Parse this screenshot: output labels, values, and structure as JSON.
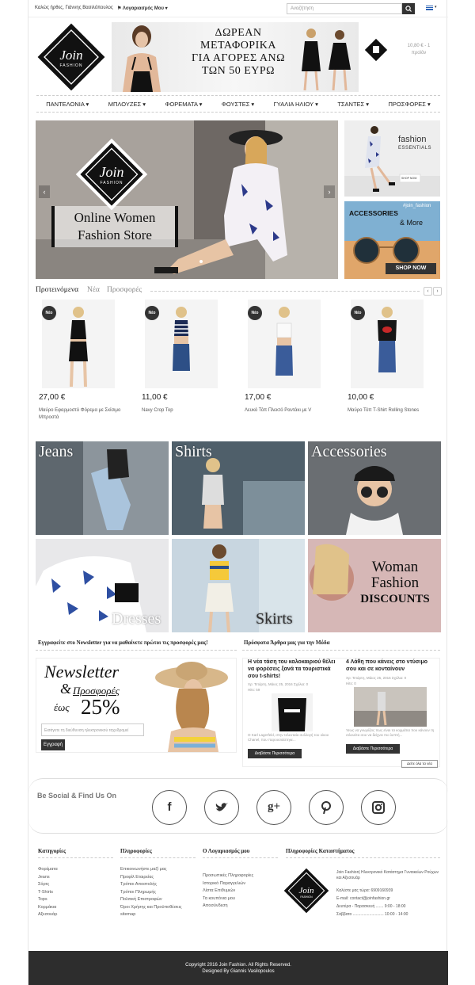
{
  "topbar": {
    "welcome": "Καλώς ήρθες, Γιάννης Βασιλόπουλος",
    "account": "Λογαριασμός Μου",
    "search_placeholder": "Αναζήτηση"
  },
  "banner": {
    "line1": "ΔΩΡΕΑΝ",
    "line2": "ΜΕΤΑΦΟΡΙΚΑ",
    "line3": "ΓΙΑ ΑΓΟΡΕΣ ΑΝΩ",
    "line4": "ΤΩΝ 50 ΕΥΡΩ"
  },
  "logo": {
    "main": "Join",
    "sub": "FASHION"
  },
  "cart": {
    "amount": "10,80 € - 1",
    "unit": "προϊόν"
  },
  "nav": [
    "ΠΑΝΤΕΛΟΝΙΑ",
    "ΜΠΛΟΥΖΕΣ",
    "ΦΟΡΕΜΑΤΑ",
    "ΦΟΥΣΤΕΣ",
    "ΓΥΑΛΙΑ ΗΛΙΟΥ",
    "ΤΣΑΝΤΕΣ",
    "ΠΡΟΣΦΟΡΕΣ"
  ],
  "hero": {
    "logo_main": "Join",
    "logo_sub": "FASHION",
    "line1": "Online Women",
    "line2": "Fashion Store"
  },
  "side1": {
    "title": "fashion",
    "subtitle": "ESSENTIALS",
    "button": "SHOP NOW"
  },
  "side2": {
    "tag": "#join_fashion",
    "title": "ACCESSORIES",
    "subtitle": "& More",
    "button": "SHOP NOW"
  },
  "tabs": [
    "Προτεινόμενα",
    "Νέα",
    "Προσφορές"
  ],
  "products": [
    {
      "badge": "Νέο",
      "price": "27,00 €",
      "name": "Μαύρο Εφαρμοστό Φόρεμα με Σκίσιμο Μπροστά"
    },
    {
      "badge": "Νέο",
      "price": "11,00 €",
      "name": "Navy Crop Top"
    },
    {
      "badge": "Νέο",
      "price": "17,00 €",
      "name": "Λευκό Τόπ Πλεκτό Ραντάκι με V"
    },
    {
      "badge": "Νέο",
      "price": "10,00 €",
      "name": "Μαύρο Τόπ T-Shirt Rolling Stones"
    }
  ],
  "categories": {
    "jeans": "Jeans",
    "shirts": "Shirts",
    "accessories": "Accessories",
    "dresses": "Dresses",
    "skirts": "Skirts",
    "woman1": "Woman",
    "woman2": "Fashion",
    "discounts": "DISCOUNTS"
  },
  "newsletter": {
    "heading": "Εγγραφείτε στο Newsletter για να μαθαίνετε πρώτοι τις προσφορές μας!",
    "title": "Newsletter",
    "amp": "&",
    "offers": "Προσφορές",
    "upto": "έως",
    "percent": "25%",
    "placeholder": "Εισάγετε τη διεύθυνση ηλεκτρονικού ταχυδρομεί",
    "button": "Εγγραφή"
  },
  "blog": {
    "heading": "Πρόσφατα Άρθρα μας για την Μόδα",
    "posts": [
      {
        "title": "Η νέα τάση του καλοκαιριού θέλει να φορέσεις ξανά τα τουριστικά σου t-shirts!",
        "meta": "Χρ: Τετάρτη, Μάιος 25, 2016 Σχόλια: 0",
        "meta2": "Hits: 59",
        "excerpt": "Ο Karl Lagerfeld, στην τελευταία συλλογή του οίκου Chanel, που παρουσιάστηκε...",
        "button": "Διαβάστε Περισσότερα"
      },
      {
        "title": "4 Λάθη που κάνεις στο ντύσιμο σου και σε κονταίνουν",
        "meta": "Χρ: Τετάρτη, Μάιος 25, 2016 Σχόλια: 0",
        "meta2": "Hits: 0",
        "excerpt": "Ίσως να γνωρίζεις πως είναι τα κορμάτια που κάνουν τη σιλουέτα σου να δείχνει πιο λεπτή...",
        "button": "Διαβάστε Περισσότερα"
      }
    ],
    "all": "Δείτε όλα τα νέα"
  },
  "social": {
    "title": "Be Social & Find Us On",
    "icons": [
      "f",
      "t",
      "g+",
      "p",
      "ig"
    ]
  },
  "footer": {
    "col1": {
      "h": "Κατηγορίες",
      "items": [
        "Φορέματα",
        "Jeans",
        "Σόρτς",
        "T-Shirts",
        "Tops",
        "Κορμάκια",
        "Αξεσουάρ"
      ]
    },
    "col2": {
      "h": "Πληροφορίες",
      "items": [
        "Επικοινωνήστε μαζί μας",
        "Προφίλ Εταιρείας",
        "Τρόποι Αποστολής",
        "Τρόποι Πληρωμής",
        "Πολιτική Επιστροφών",
        "Όροι Χρήσης και Προϋποθέσεις",
        "sitemap"
      ]
    },
    "col3": {
      "h": "Ο Λογαριασμός μου",
      "items": [
        "Προσωπικές Πληροφορίες",
        "Ιστορικό Παραγγελιών",
        "Λίστα Επιθυμιών",
        "Τα κουπόνια μου",
        "Αποσύνδεση"
      ]
    },
    "col4": {
      "h": "Πληροφορίες Καταστήματος",
      "desc": "Join Fashion| Ηλεκτρονικό Κατάστημα Γυναικείων Ρούχων και Αξεσουάρ",
      "phone": "Καλέστε μας τώρα: 6909160939",
      "email": "E-mail: contact@joinfashion.gr",
      "hours1": "Δευτέρα - Παρασκευή ....... 9:00 - 18:00",
      "hours2": "Σάββατο ............................ 10:00 - 14:00"
    }
  },
  "copyright": {
    "line1": "Copyright 2016 Join Fashion. All Rights Reserved.",
    "line2": "Designed By Giannis Vasilopoulos"
  }
}
